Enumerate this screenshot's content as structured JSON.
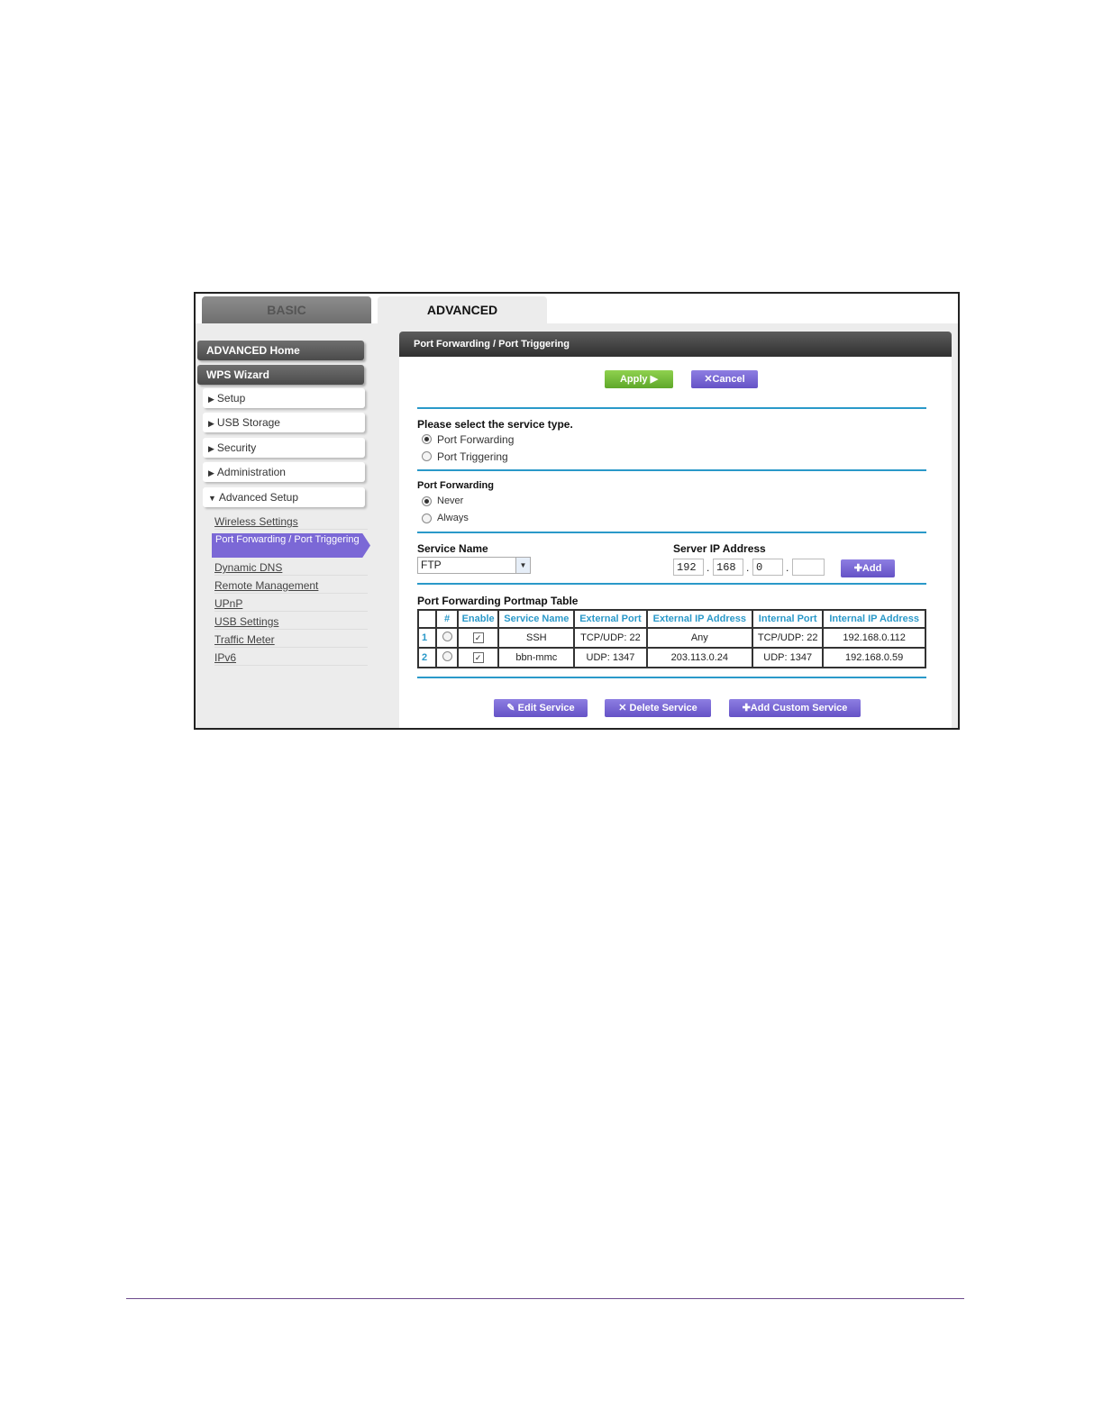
{
  "tabs": {
    "basic": "BASIC",
    "advanced": "ADVANCED"
  },
  "sidebar": {
    "top": [
      "ADVANCED Home",
      "WPS Wizard"
    ],
    "sections": [
      {
        "arrow": "▶",
        "label": "Setup"
      },
      {
        "arrow": "▶",
        "label": "USB Storage"
      },
      {
        "arrow": "▶",
        "label": "Security"
      },
      {
        "arrow": "▶",
        "label": "Administration"
      },
      {
        "arrow": "▼",
        "label": "Advanced Setup"
      }
    ],
    "subitems": [
      "Wireless Settings",
      "Port Forwarding / Port Triggering",
      "Dynamic DNS",
      "Remote Management",
      "UPnP",
      "USB Settings",
      "Traffic Meter",
      "IPv6"
    ]
  },
  "panel": {
    "title": "Port Forwarding / Port Triggering",
    "apply": "Apply ▶",
    "cancel": "✕Cancel",
    "service_type_label": "Please select the service type.",
    "service_type_options": [
      "Port Forwarding",
      "Port Triggering"
    ],
    "service_type_selected": 0,
    "pf_label": "Port Forwarding",
    "pf_options": [
      "Never",
      "Always"
    ],
    "pf_selected": 0,
    "service_name_label": "Service Name",
    "service_name_value": "FTP",
    "server_ip_label": "Server IP Address",
    "ip": [
      "192",
      "168",
      "0",
      ""
    ],
    "add": "✚Add",
    "table_title": "Port Forwarding Portmap Table",
    "table_headers": [
      "",
      "#",
      "Enable",
      "Service Name",
      "External Port",
      "External IP Address",
      "Internal Port",
      "Internal IP Address"
    ],
    "rows": [
      {
        "idx": "1",
        "enable": "✓",
        "service": "SSH",
        "ext_port": "TCP/UDP: 22",
        "ext_ip": "Any",
        "int_port": "TCP/UDP: 22",
        "int_ip": "192.168.0.112"
      },
      {
        "idx": "2",
        "enable": "✓",
        "service": "bbn-mmc",
        "ext_port": "UDP: 1347",
        "ext_ip": "203.113.0.24",
        "int_port": "UDP: 1347",
        "int_ip": "192.168.0.59"
      }
    ],
    "edit": "✎ Edit Service",
    "delete": "✕ Delete Service",
    "add_custom": "✚Add Custom Service"
  }
}
